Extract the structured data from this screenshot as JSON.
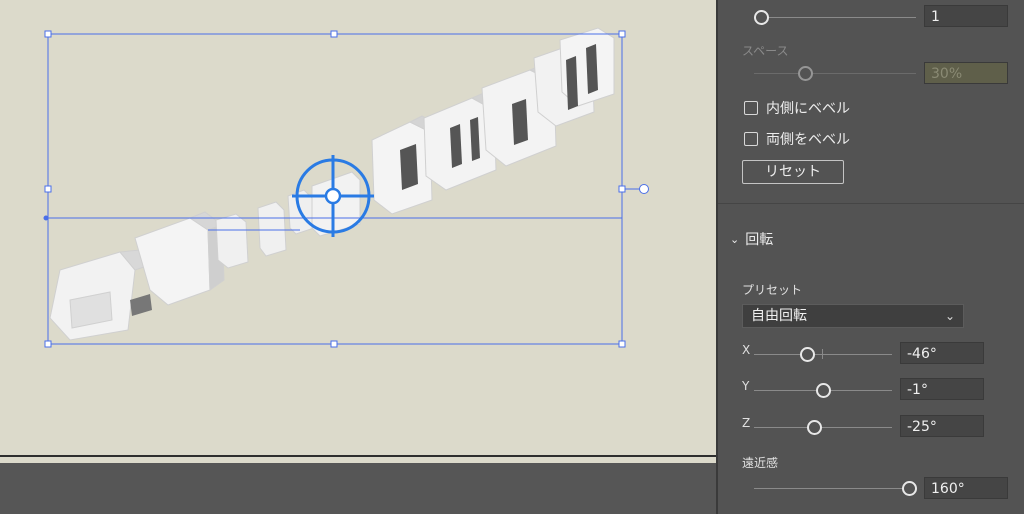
{
  "canvas": {
    "letters": [
      "a",
      "b",
      "i",
      "l",
      "i",
      "t",
      "y",
      "s",
      "k",
      "i",
      "l",
      "l"
    ]
  },
  "panel": {
    "top_value": "1",
    "spacing_label": "スペース",
    "spacing_value": "30%",
    "bevel_inside_label": "内側にベベル",
    "bevel_both_label": "両側をベベル",
    "reset_label": "リセット",
    "rotation_section": "回転",
    "preset_label": "プリセット",
    "preset_value": "自由回転",
    "x_label": "X",
    "x_value": "-46°",
    "y_label": "Y",
    "y_value": "-1°",
    "z_label": "Z",
    "z_value": "-25°",
    "perspective_label": "遠近感",
    "perspective_value": "160°"
  }
}
